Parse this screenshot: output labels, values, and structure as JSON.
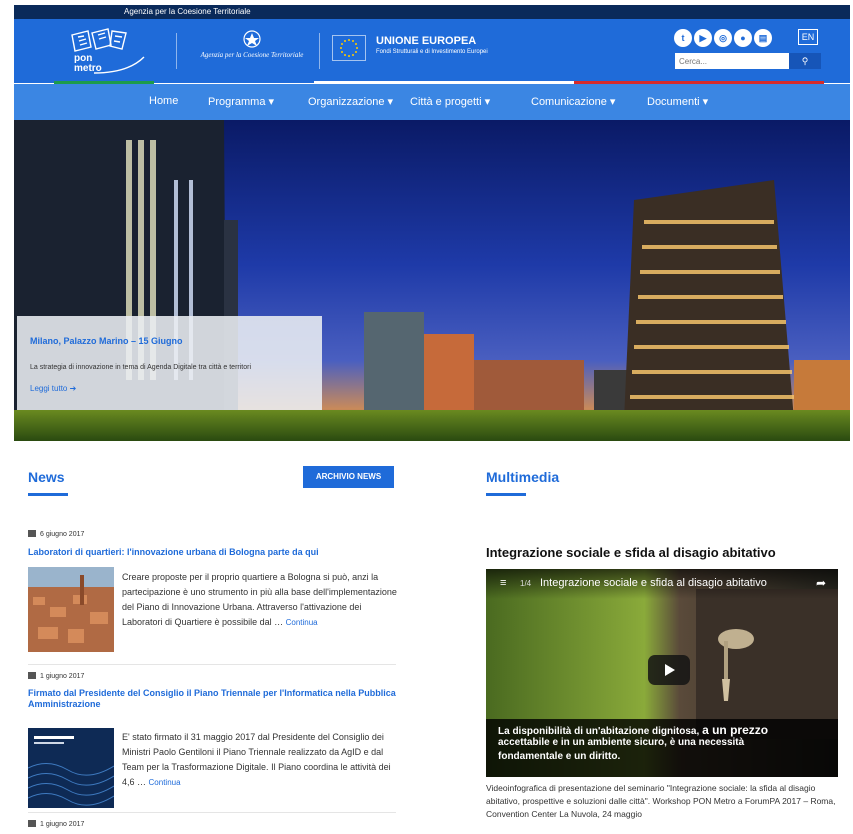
{
  "topbar": {
    "agency": "Agenzia per la Coesione Territoriale"
  },
  "header": {
    "logo_line1": "pon",
    "logo_line2": "metro",
    "agency_name": "Agenzia per la Coesione Territoriale",
    "eu_title": "UNIONE EUROPEA",
    "eu_subtitle": "Fondi Strutturali e di Investimento Europei",
    "lang": "EN",
    "search_placeholder": "Cerca...",
    "social": [
      {
        "icon": "twitter-icon",
        "glyph": "t"
      },
      {
        "icon": "youtube-icon",
        "glyph": "▶"
      },
      {
        "icon": "instagram-icon",
        "glyph": "◎"
      },
      {
        "icon": "flickr-icon",
        "glyph": "●"
      },
      {
        "icon": "slideshare-icon",
        "glyph": "▤"
      }
    ]
  },
  "nav": {
    "items": [
      "Home",
      "Programma ▾",
      "Organizzazione ▾",
      "Città e progetti ▾",
      "Comunicazione ▾",
      "Documenti ▾"
    ]
  },
  "hero": {
    "caption_title": "Milano, Palazzo Marino – 15 Giugno",
    "caption_text": "La strategia di innovazione in tema di Agenda Digitale tra città e territori",
    "caption_link": "Leggi tutto ➔"
  },
  "news": {
    "title": "News",
    "archive_button": "ARCHIVIO NEWS",
    "items": [
      {
        "date": "6 giugno 2017",
        "title": "Laboratori di quartieri: l'innovazione urbana di Bologna parte da qui",
        "text": "Creare proposte per il proprio quartiere a Bologna si può, anzi la partecipazione è uno strumento in più alla base dell'implementazione del Piano di Innovazione Urbana. Attraverso l'attivazione dei Laboratori di Quartiere è possibile dal …",
        "more": "Continua"
      },
      {
        "date": "1 giugno 2017",
        "title": "Firmato dal Presidente del Consiglio il Piano Triennale per l'Informatica nella Pubblica Amministrazione",
        "text": "E' stato firmato il 31 maggio 2017 dal Presidente del Consiglio dei Ministri Paolo Gentiloni il Piano Triennale realizzato da AgID e dal Team per la Trasformazione Digitale. Il Piano coordina le attività dei 4,6 …",
        "more": "Continua"
      },
      {
        "date": "1 giugno 2017"
      }
    ]
  },
  "multimedia": {
    "title": "Multimedia",
    "video_title": "Integrazione sociale e sfida al disagio abitativo",
    "playlist_counter": "1/4",
    "player_title": "Integrazione sociale e sfida al disagio abitativo",
    "subtitle_line1": "La disponibilità di un'abitazione dignitosa,",
    "subtitle_line1b": "a un prezzo",
    "subtitle_line2": "accettabile e in un ambiente sicuro, è una necessità",
    "subtitle_line3": "fondamentale e un diritto.",
    "description": "Videoinfografica di presentazione del seminario \"Integrazione sociale: la sfida al disagio abitativo, prospettive e soluzioni dalle città\". Workshop PON Metro a ForumPA 2017 – Roma, Convention Center La Nuvola, 24 maggio"
  },
  "colors": {
    "primary": "#1f6bd9",
    "nav": "#3b86e3",
    "topbar": "#0a2a5a"
  }
}
